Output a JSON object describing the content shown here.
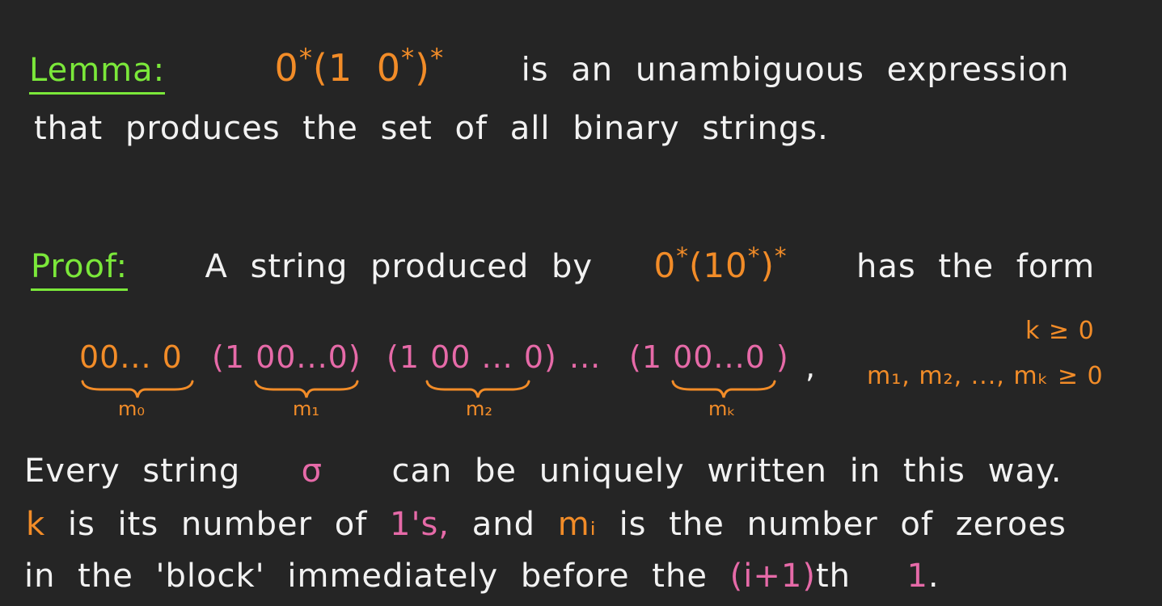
{
  "lemma": {
    "label": "Lemma:",
    "expr_base": "0",
    "expr_star1": "*",
    "expr_group_open": "(1 0",
    "expr_star2": "*",
    "expr_group_close": ")",
    "expr_star3": "*",
    "text_line1": "is an unambiguous expression",
    "text_line2": "that produces the set of all binary strings."
  },
  "proof": {
    "label": "Proof:",
    "intro": "A string produced by",
    "expr_base": "0",
    "expr_star1": "*",
    "expr_group_open": "(10",
    "expr_star2": "*",
    "expr_group_close": ")",
    "expr_star3": "*",
    "outro": "has the form"
  },
  "form": {
    "block0": "00... 0",
    "block1": "(1 00...0)",
    "block2": "(1 00 ... 0)",
    "ellipsis": "...",
    "blockk": "(1 00...0 )",
    "comma": ",",
    "labels": [
      "m₀",
      "m₁",
      "m₂",
      "mₖ"
    ],
    "cond_k": "k ≥ 0",
    "cond_m": "m₁, m₂, ..., mₖ ≥ 0"
  },
  "body": {
    "l1_a": "Every string",
    "l1_sigma": "σ",
    "l1_b": "can be uniquely written in this way.",
    "l2_k": "k",
    "l2_a": "is its number of",
    "l2_ones": "1's,",
    "l2_b": "and",
    "l2_mi": "mᵢ",
    "l2_c": "is the number of zeroes",
    "l3_a": "in the 'block' immediately before the",
    "l3_i": "(i+1)",
    "l3_b": "th",
    "l3_one": "1",
    "l3_dot": "."
  },
  "colors": {
    "background": "#252525",
    "heading": "#7be83a",
    "expression": "#f28c28",
    "highlight": "#e66aa8",
    "text": "#f2f2f2"
  }
}
